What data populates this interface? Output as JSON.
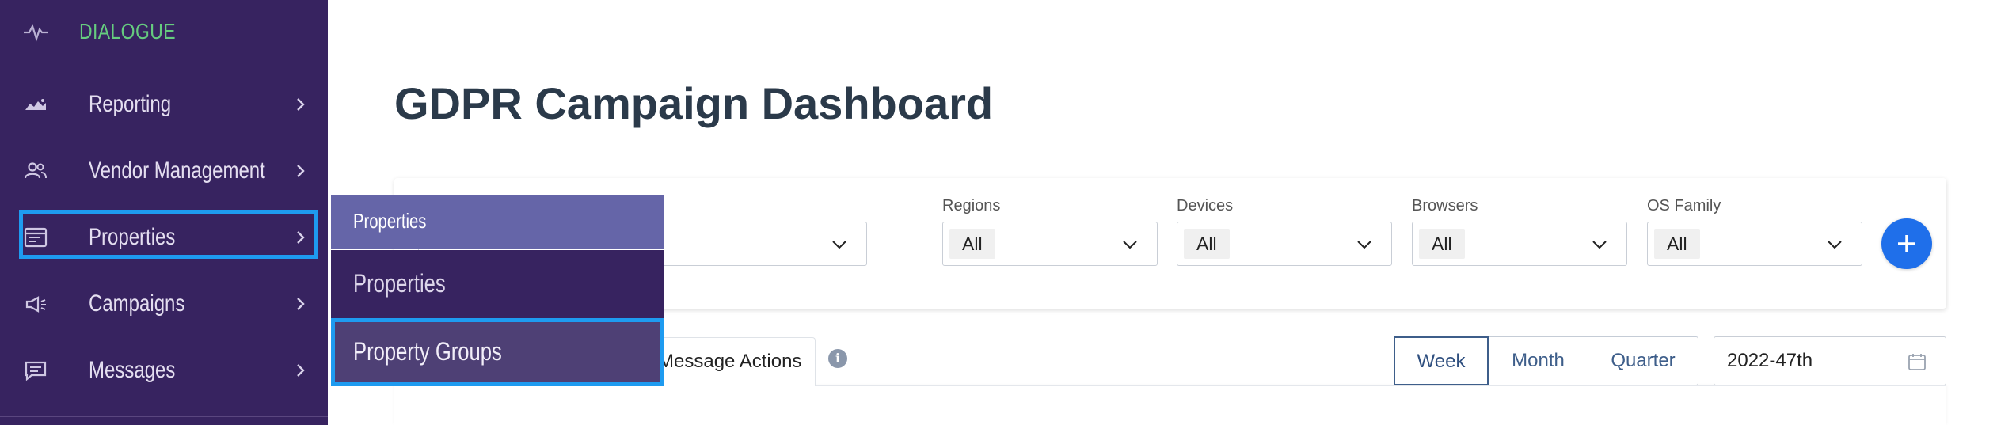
{
  "brand": {
    "name": "DIALOGUE",
    "icon": "pulse-icon"
  },
  "sidebar": {
    "items": [
      {
        "label": "Reporting",
        "icon": "chart-icon"
      },
      {
        "label": "Vendor Management",
        "icon": "users-icon"
      },
      {
        "label": "Properties",
        "icon": "window-icon",
        "highlighted": true
      },
      {
        "label": "Campaigns",
        "icon": "megaphone-icon"
      },
      {
        "label": "Messages",
        "icon": "message-icon"
      }
    ]
  },
  "flyout": {
    "header": "Properties",
    "items": [
      {
        "label": "Properties"
      },
      {
        "label": "Property Groups",
        "active": true
      }
    ]
  },
  "main": {
    "title": "GDPR Campaign Dashboard",
    "filters": [
      {
        "label": "Regions",
        "value": "All"
      },
      {
        "label": "Devices",
        "value": "All"
      },
      {
        "label": "Browsers",
        "value": "All"
      },
      {
        "label": "OS Family",
        "value": "All"
      }
    ],
    "tab": "Message Actions",
    "info_icon": "i",
    "periods": [
      "Week",
      "Month",
      "Quarter"
    ],
    "active_period": "Week",
    "date_value": "2022-47th"
  },
  "colors": {
    "sidebar_bg": "#372360",
    "brand_green": "#66cc7f",
    "highlight_blue": "#1e9bf0",
    "flyout_header": "#6565a8",
    "add_button": "#1f6fea",
    "title_text": "#2b3a4a"
  }
}
